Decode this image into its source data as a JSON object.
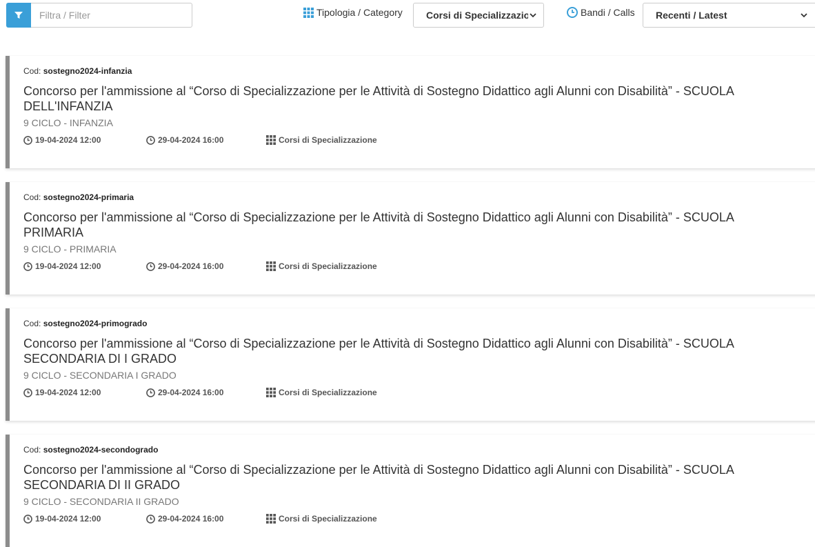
{
  "toolbar": {
    "filter_placeholder": "Filtra / Filter",
    "category_label": "Tipologia / Category",
    "category_selected": "Corsi di Specializzazione",
    "calls_label": "Bandi / Calls",
    "calls_selected": "Recenti / Latest"
  },
  "colors": {
    "accent": "#3a9fd8",
    "card_border": "#8c8c8c"
  },
  "cards": [
    {
      "cod_label": "Cod:",
      "cod_value": "sostegno2024-infanzia",
      "title": "Concorso per l'ammissione al “Corso di Specializzazione per le Attività di Sostegno Didattico agli Alunni con Disabilità” - SCUOLA DELL'INFANZIA",
      "subtitle": "9 CICLO - INFANZIA",
      "start": "19-04-2024 12:00",
      "end": "29-04-2024 16:00",
      "category": "Corsi di Specializzazione"
    },
    {
      "cod_label": "Cod:",
      "cod_value": "sostegno2024-primaria",
      "title": "Concorso per l'ammissione al “Corso di Specializzazione per le Attività di Sostegno Didattico agli Alunni con Disabilità” - SCUOLA PRIMARIA",
      "subtitle": "9 CICLO - PRIMARIA",
      "start": "19-04-2024 12:00",
      "end": "29-04-2024 16:00",
      "category": "Corsi di Specializzazione"
    },
    {
      "cod_label": "Cod:",
      "cod_value": "sostegno2024-primogrado",
      "title": "Concorso per l'ammissione al “Corso di Specializzazione per le Attività di Sostegno Didattico agli Alunni con Disabilità” - SCUOLA SECONDARIA DI I GRADO",
      "subtitle": "9 CICLO - SECONDARIA I GRADO",
      "start": "19-04-2024 12:00",
      "end": "29-04-2024 16:00",
      "category": "Corsi di Specializzazione"
    },
    {
      "cod_label": "Cod:",
      "cod_value": "sostegno2024-secondogrado",
      "title": "Concorso per l'ammissione al “Corso di Specializzazione per le Attività di Sostegno Didattico agli Alunni con Disabilità” - SCUOLA SECONDARIA DI II GRADO",
      "subtitle": "9 CICLO - SECONDARIA II GRADO",
      "start": "19-04-2024 12:00",
      "end": "29-04-2024 16:00",
      "category": "Corsi di Specializzazione"
    }
  ]
}
